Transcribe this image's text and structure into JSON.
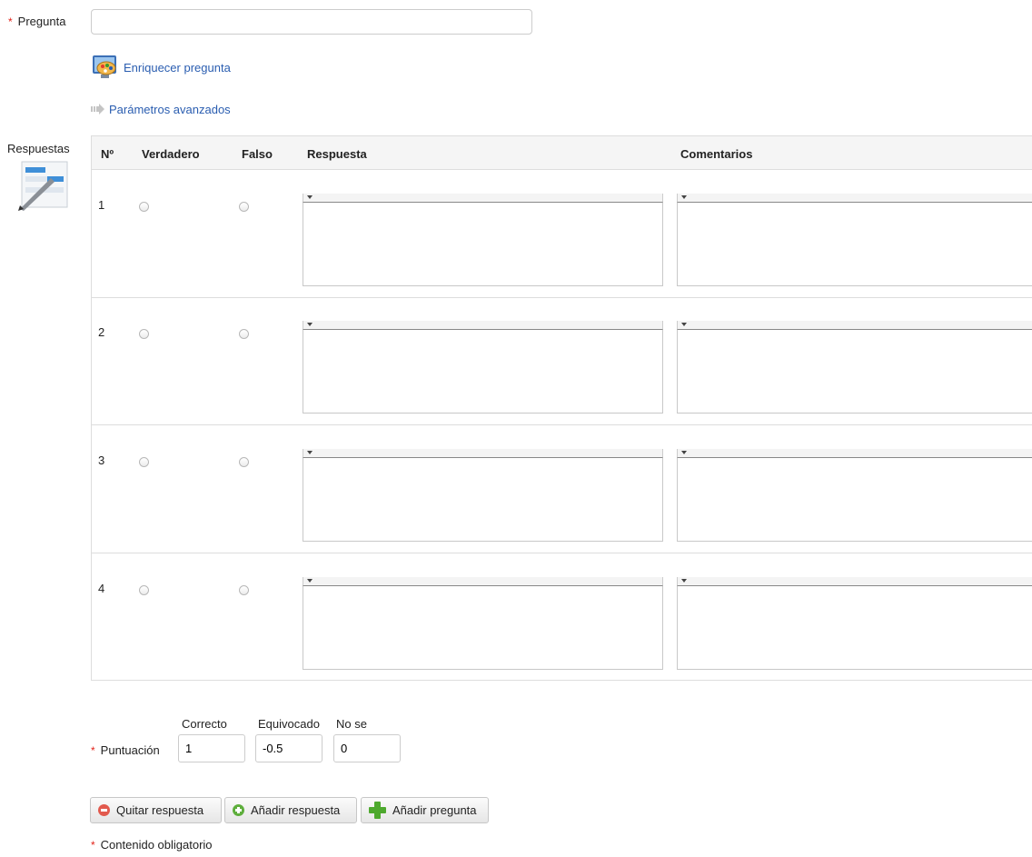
{
  "pregunta": {
    "label": "Pregunta",
    "required_mark": "*",
    "value": ""
  },
  "enrich_link": {
    "label": "Enriquecer pregunta",
    "icon": "palette-monitor-icon"
  },
  "advanced_link": {
    "label": "Parámetros avanzados",
    "icon": "arrow-right-icon"
  },
  "respuestas": {
    "label": "Respuestas",
    "icon": "edit-list-icon",
    "columns": {
      "num": "Nº",
      "true": "Verdadero",
      "false": "Falso",
      "answer": "Respuesta",
      "comments": "Comentarios"
    },
    "rows": [
      {
        "num": "1",
        "answer": "",
        "comment": ""
      },
      {
        "num": "2",
        "answer": "",
        "comment": ""
      },
      {
        "num": "3",
        "answer": "",
        "comment": ""
      },
      {
        "num": "4",
        "answer": "",
        "comment": ""
      }
    ]
  },
  "score": {
    "label": "Puntuación",
    "required_mark": "*",
    "correct_label": "Correcto",
    "wrong_label": "Equivocado",
    "unknown_label": "No se",
    "correct_value": "1",
    "wrong_value": "-0.5",
    "unknown_value": "0"
  },
  "buttons": {
    "remove_answer": "Quitar respuesta",
    "add_answer": "Añadir respuesta",
    "add_question": "Añadir pregunta"
  },
  "footer": {
    "required_mark": "*",
    "note": "Contenido obligatorio"
  },
  "colors": {
    "link": "#2a5db0",
    "required": "#e2231a",
    "header_bg": "#f5f5f5",
    "border": "#dddddd"
  }
}
